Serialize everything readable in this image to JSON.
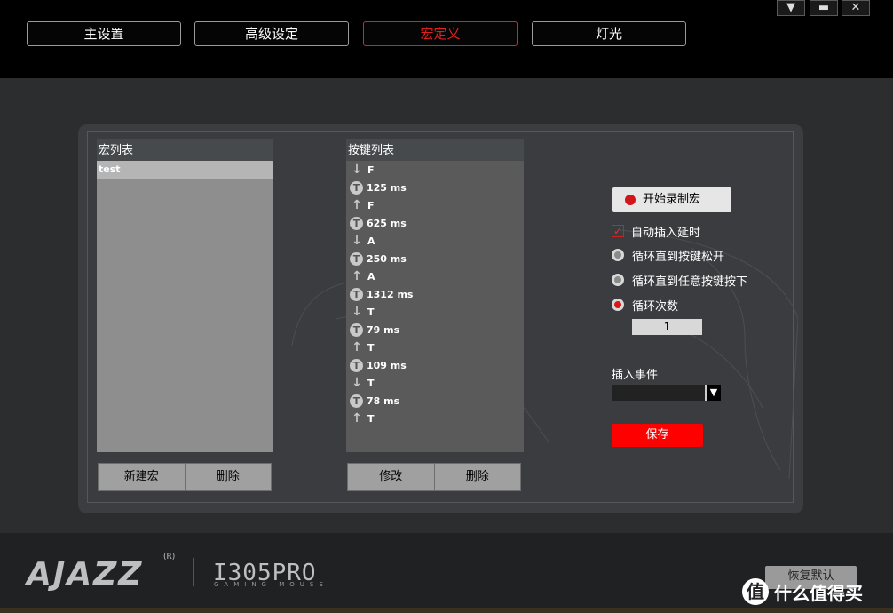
{
  "tabs": [
    {
      "label": "主设置",
      "active": false
    },
    {
      "label": "高级设定",
      "active": false
    },
    {
      "label": "宏定义",
      "active": true
    },
    {
      "label": "灯光",
      "active": false
    }
  ],
  "window_controls": {
    "menu_icon": "triangle-down-icon",
    "minimize_icon": "minimize-icon",
    "close_icon": "close-icon"
  },
  "macro_list": {
    "header": "宏列表",
    "items": [
      "test"
    ],
    "new_button": "新建宏",
    "delete_button": "删除"
  },
  "key_list": {
    "header": "按键列表",
    "rows": [
      {
        "icon": "arrow-down-icon",
        "text": "F"
      },
      {
        "icon": "timer-icon",
        "text": "125 ms"
      },
      {
        "icon": "arrow-up-icon",
        "text": "F"
      },
      {
        "icon": "timer-icon",
        "text": "625 ms"
      },
      {
        "icon": "arrow-down-icon",
        "text": "A"
      },
      {
        "icon": "timer-icon",
        "text": "250 ms"
      },
      {
        "icon": "arrow-up-icon",
        "text": "A"
      },
      {
        "icon": "timer-icon",
        "text": "1312 ms"
      },
      {
        "icon": "arrow-down-icon",
        "text": "T"
      },
      {
        "icon": "timer-icon",
        "text": "79 ms"
      },
      {
        "icon": "arrow-up-icon",
        "text": "T"
      },
      {
        "icon": "timer-icon",
        "text": "109 ms"
      },
      {
        "icon": "arrow-down-icon",
        "text": "T"
      },
      {
        "icon": "timer-icon",
        "text": "78 ms"
      },
      {
        "icon": "arrow-up-icon",
        "text": "T"
      }
    ],
    "edit_button": "修改",
    "delete_button": "删除"
  },
  "options": {
    "record_button": "开始录制宏",
    "auto_delay": "自动插入延时",
    "auto_delay_checked": true,
    "loop_until_release": "循环直到按键松开",
    "loop_until_any_key": "循环直到任意按键按下",
    "loop_count": "循环次数",
    "loop_mode_selected": "loop_count",
    "loop_count_value": "1",
    "insert_event_label": "插入事件",
    "insert_event_value": "",
    "save_button": "保存"
  },
  "footer": {
    "brand": "AJAZZ",
    "registered": "R",
    "model": "I305PRO",
    "model_sub": "GAMING MOUSE",
    "restore_button": "恢复默认",
    "watermark_icon": "值",
    "watermark_text": "什么值得买"
  },
  "colors": {
    "accent": "#e02020",
    "save": "#ff0000",
    "panel": "#3b3d40"
  }
}
